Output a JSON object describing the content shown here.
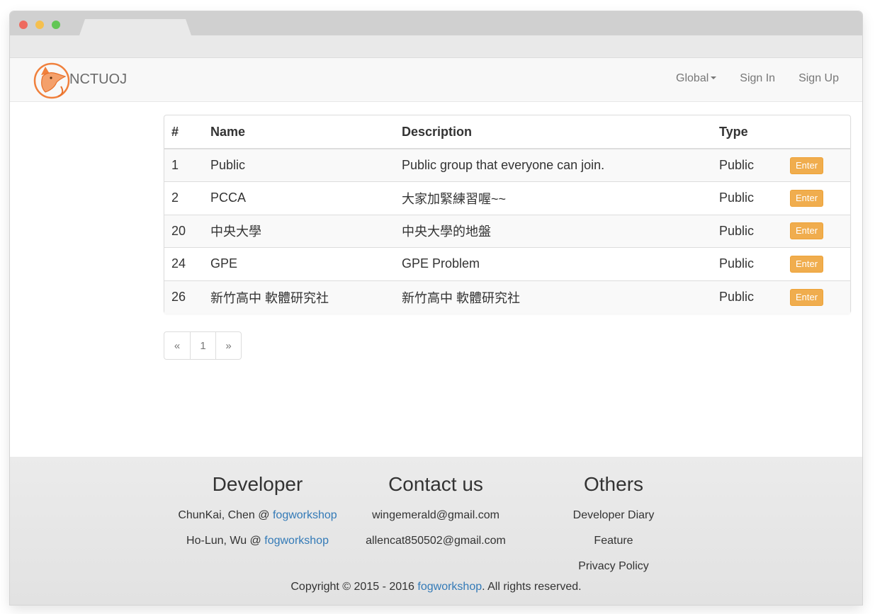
{
  "brand": {
    "name": "NCTUOJ"
  },
  "nav": {
    "global": "Global",
    "sign_in": "Sign In",
    "sign_up": "Sign Up"
  },
  "table": {
    "headers": [
      "#",
      "Name",
      "Description",
      "Type",
      ""
    ],
    "rows": [
      {
        "id": "1",
        "name": "Public",
        "description": "Public group that everyone can join.",
        "type": "Public",
        "action": "Enter"
      },
      {
        "id": "2",
        "name": "PCCA",
        "description": "大家加緊練習喔~~",
        "type": "Public",
        "action": "Enter"
      },
      {
        "id": "20",
        "name": "中央大學",
        "description": "中央大學的地盤",
        "type": "Public",
        "action": "Enter"
      },
      {
        "id": "24",
        "name": "GPE",
        "description": "GPE Problem",
        "type": "Public",
        "action": "Enter"
      },
      {
        "id": "26",
        "name": "新竹高中 軟體研究社",
        "description": "新竹高中 軟體研究社",
        "type": "Public",
        "action": "Enter"
      }
    ]
  },
  "pagination": {
    "prev": "«",
    "page": "1",
    "next": "»"
  },
  "footer": {
    "developer": {
      "title": "Developer",
      "lines": [
        {
          "text": "ChunKai, Chen @ ",
          "link": "fogworkshop"
        },
        {
          "text": "Ho-Lun, Wu @ ",
          "link": "fogworkshop"
        }
      ]
    },
    "contact": {
      "title": "Contact us",
      "emails": [
        "wingemerald@gmail.com",
        "allencat850502@gmail.com"
      ]
    },
    "others": {
      "title": "Others",
      "links": [
        "Developer Diary",
        "Feature",
        "Privacy Policy"
      ]
    },
    "copyright": {
      "prefix": "Copyright © 2015 - 2016 ",
      "link": "fogworkshop",
      "suffix": ". All rights reserved."
    }
  },
  "colors": {
    "accent": "#f0ad4e",
    "link": "#337ab7",
    "logo": "#f0803c"
  },
  "icons": {
    "logo": "fox-logo-icon",
    "dropdown": "caret-down-icon"
  }
}
